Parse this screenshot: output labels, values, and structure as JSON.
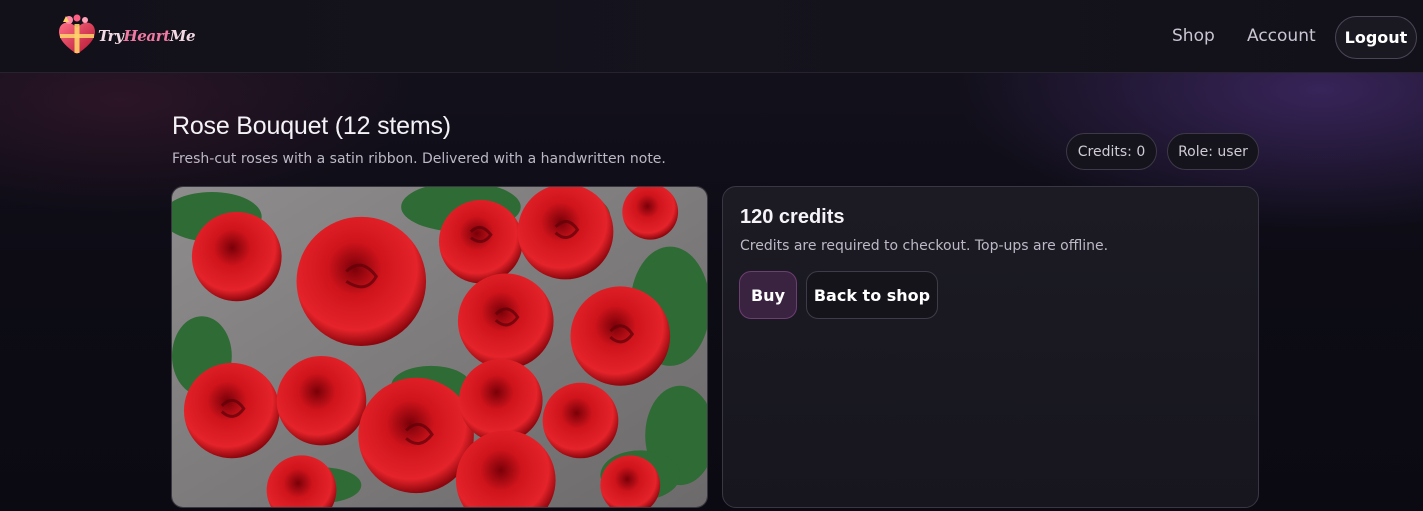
{
  "header": {
    "logo": {
      "brand_text_prefix": "Try",
      "brand_text_heart": "Heart",
      "brand_text_suffix": "Me",
      "icon": "gift-heart-icon"
    },
    "nav": [
      {
        "label": "Shop"
      },
      {
        "label": "Account"
      }
    ],
    "logout_label": "Logout"
  },
  "product": {
    "title": "Rose Bouquet (12 stems)",
    "description": "Fresh-cut roses with a satin ribbon. Delivered with a handwritten note.",
    "image_alt": "red-roses-photo"
  },
  "status": {
    "credits_label": "Credits: 0",
    "role_label": "Role: user"
  },
  "purchase_panel": {
    "price": "120 credits",
    "note": "Credits are required to checkout. Top-ups are offline.",
    "buy_label": "Buy",
    "back_label": "Back to shop"
  },
  "colors": {
    "accent_buy_bg": "#3a2340",
    "accent_buy_border": "#6d3e72",
    "background": "#0c0b14",
    "rose_red": "#c4121a"
  }
}
